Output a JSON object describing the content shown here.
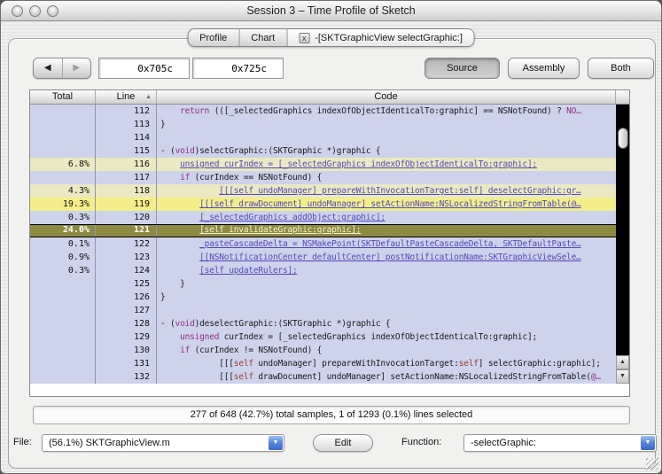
{
  "window": {
    "title": "Session 3 – Time Profile of Sketch"
  },
  "icons": {
    "back": "◀",
    "forward": "▶",
    "sort_ascending": "▲",
    "scroll_up": "▲",
    "scroll_down": "▼",
    "popup_arrow": "▼",
    "tab_close": "x"
  },
  "tabs": [
    {
      "label": "Profile",
      "active": false
    },
    {
      "label": "Chart",
      "active": false
    },
    {
      "label": "-[SKTGraphicView selectGraphic:]",
      "active": true,
      "closable": true
    }
  ],
  "toolbar": {
    "address_start": "0x705c",
    "address_end": "0x725c",
    "view_buttons": [
      {
        "label": "Source",
        "selected": true
      },
      {
        "label": "Assembly",
        "selected": false
      },
      {
        "label": "Both",
        "selected": false
      }
    ]
  },
  "table": {
    "columns": [
      "Total",
      "Line",
      "Code"
    ],
    "rows": [
      {
        "total": "",
        "line": "112",
        "heat": "default",
        "code": [
          {
            "t": "    ",
            "s": "p"
          },
          {
            "t": "return",
            "s": "k"
          },
          {
            "t": " (([_selectedGraphics indexOfObjectIdenticalTo:graphic] == NSNotFound) ? ",
            "s": "p"
          },
          {
            "t": "NO…",
            "s": "k"
          }
        ]
      },
      {
        "total": "",
        "line": "113",
        "heat": "default",
        "code": [
          {
            "t": "}",
            "s": "p"
          }
        ]
      },
      {
        "total": "",
        "line": "114",
        "heat": "default",
        "code": []
      },
      {
        "total": "",
        "line": "115",
        "heat": "default",
        "code": [
          {
            "t": "- (",
            "s": "p"
          },
          {
            "t": "void",
            "s": "k"
          },
          {
            "t": ")selectGraphic:(SKTGraphic *)graphic {",
            "s": "p"
          }
        ]
      },
      {
        "total": "6.8%",
        "line": "116",
        "heat": "low",
        "code": [
          {
            "t": "    ",
            "s": "p"
          },
          {
            "t": "unsigned curIndex = [_selectedGraphics indexOfObjectIdenticalTo:graphic];",
            "s": "l"
          }
        ]
      },
      {
        "total": "",
        "line": "117",
        "heat": "default",
        "code": [
          {
            "t": "    ",
            "s": "p"
          },
          {
            "t": "if",
            "s": "k"
          },
          {
            "t": " (curIndex == NSNotFound) {",
            "s": "p"
          }
        ]
      },
      {
        "total": "4.3%",
        "line": "118",
        "heat": "low",
        "code": [
          {
            "t": "            ",
            "s": "p"
          },
          {
            "t": "[[[self undoManager] prepareWithInvocationTarget:self] deselectGraphic:gr…",
            "s": "l"
          }
        ]
      },
      {
        "total": "19.3%",
        "line": "119",
        "heat": "high",
        "code": [
          {
            "t": "        ",
            "s": "p"
          },
          {
            "t": "[[[self drawDocument] undoManager] setActionName:NSLocalizedStringFromTable(@…",
            "s": "l"
          }
        ]
      },
      {
        "total": "0.3%",
        "line": "120",
        "heat": "default",
        "code": [
          {
            "t": "        ",
            "s": "p"
          },
          {
            "t": "[_selectedGraphics addObject:graphic];",
            "s": "l"
          }
        ]
      },
      {
        "total": "24.0%",
        "line": "121",
        "heat": "selected",
        "code": [
          {
            "t": "        ",
            "s": "p"
          },
          {
            "t": "[self invalidateGraphic:graphic];",
            "s": "l"
          }
        ]
      },
      {
        "total": "0.1%",
        "line": "122",
        "heat": "default",
        "code": [
          {
            "t": "        ",
            "s": "p"
          },
          {
            "t": "_pasteCascadeDelta = NSMakePoint(SKTDefaultPasteCascadeDelta, SKTDefaultPaste…",
            "s": "l"
          }
        ]
      },
      {
        "total": "0.9%",
        "line": "123",
        "heat": "default",
        "code": [
          {
            "t": "        ",
            "s": "p"
          },
          {
            "t": "[[NSNotificationCenter defaultCenter] postNotificationName:SKTGraphicViewSele…",
            "s": "l"
          }
        ]
      },
      {
        "total": "0.3%",
        "line": "124",
        "heat": "default",
        "code": [
          {
            "t": "        ",
            "s": "p"
          },
          {
            "t": "[self updateRulers];",
            "s": "l"
          }
        ]
      },
      {
        "total": "",
        "line": "125",
        "heat": "default",
        "code": [
          {
            "t": "    }",
            "s": "p"
          }
        ]
      },
      {
        "total": "",
        "line": "126",
        "heat": "default",
        "code": [
          {
            "t": "}",
            "s": "p"
          }
        ]
      },
      {
        "total": "",
        "line": "127",
        "heat": "default",
        "code": []
      },
      {
        "total": "",
        "line": "128",
        "heat": "default",
        "code": [
          {
            "t": "- (",
            "s": "p"
          },
          {
            "t": "void",
            "s": "k"
          },
          {
            "t": ")deselectGraphic:(SKTGraphic *)graphic {",
            "s": "p"
          }
        ]
      },
      {
        "total": "",
        "line": "129",
        "heat": "default",
        "code": [
          {
            "t": "    ",
            "s": "p"
          },
          {
            "t": "unsigned",
            "s": "k"
          },
          {
            "t": " curIndex = [_selectedGraphics indexOfObjectIdenticalTo:graphic];",
            "s": "p"
          }
        ]
      },
      {
        "total": "",
        "line": "130",
        "heat": "default",
        "code": [
          {
            "t": "    ",
            "s": "p"
          },
          {
            "t": "if",
            "s": "k"
          },
          {
            "t": " (curIndex != NSNotFound) {",
            "s": "p"
          }
        ]
      },
      {
        "total": "",
        "line": "131",
        "heat": "default",
        "code": [
          {
            "t": "            [[[",
            "s": "p"
          },
          {
            "t": "self",
            "s": "r"
          },
          {
            "t": " undoManager] prepareWithInvocationTarget:",
            "s": "p"
          },
          {
            "t": "self",
            "s": "r"
          },
          {
            "t": "] selectGraphic:graphic];",
            "s": "p"
          }
        ]
      },
      {
        "total": "",
        "line": "132",
        "heat": "default",
        "code": [
          {
            "t": "            [[[",
            "s": "p"
          },
          {
            "t": "self",
            "s": "r"
          },
          {
            "t": " drawDocument] undoManager] setActionName:NSLocalizedStringFromTable(",
            "s": "p"
          },
          {
            "t": "@…",
            "s": "k"
          }
        ]
      }
    ]
  },
  "status_bar": {
    "text": "277 of 648 (42.7%) total samples, 1 of 1293 (0.1%) lines selected"
  },
  "footer": {
    "file_label": "File:",
    "file_value": "(56.1%) SKTGraphicView.m",
    "edit_label": "Edit",
    "function_label": "Function:",
    "function_value": "-selectGraphic:"
  },
  "colors": {
    "row_default": "#ccd3ea",
    "row_heat_low": "#ebe9c1",
    "row_heat_high": "#f3ee8a",
    "row_selected": "#8f8a42",
    "link_text": "#5149bd",
    "keyword_text": "#992b85",
    "self_keyword_text": "#a03a32",
    "scroll_track": "#000000",
    "popup_accent": "#4a77d4"
  }
}
